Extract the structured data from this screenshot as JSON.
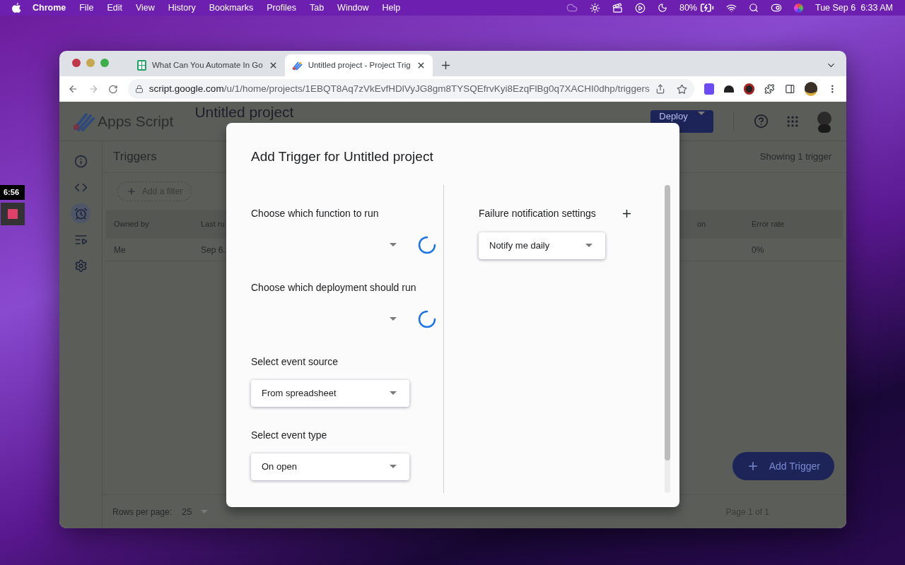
{
  "menubar": {
    "app": "Chrome",
    "menus": [
      "File",
      "Edit",
      "View",
      "History",
      "Bookmarks",
      "Profiles",
      "Tab",
      "Window",
      "Help"
    ],
    "battery": "80%",
    "clock": "Tue Sep 6  6:33 AM"
  },
  "recorder": {
    "time": "6:56"
  },
  "browser": {
    "tabs": [
      {
        "title": "What Can You Automate In Go",
        "kind": "sheets",
        "selected": false
      },
      {
        "title": "Untitled project - Project Trig",
        "kind": "script",
        "selected": true
      }
    ],
    "url": {
      "host": "script.google.com",
      "path": "/u/1/home/projects/1EBQT8Aq7zVkEvfHDlVyJG8gm8TYSQEfrvKyi8EzqFlBg0q7XACHI0dhp/triggers"
    }
  },
  "app": {
    "product": "Apps Script",
    "project": "Untitled project",
    "deploy": "Deploy",
    "nav": [
      {
        "kind": "info",
        "selected": false
      },
      {
        "kind": "code",
        "selected": false
      },
      {
        "kind": "clock",
        "selected": true
      },
      {
        "kind": "executions",
        "selected": false
      },
      {
        "kind": "settings",
        "selected": false
      }
    ],
    "title": "Triggers",
    "count": "Showing 1 trigger",
    "filter": "Add a filter",
    "table": {
      "columns": [
        "Owned by",
        "Last ru",
        "on",
        "Error rate"
      ],
      "rows": [
        [
          "Me",
          "Sep 6.",
          "",
          "0%"
        ]
      ]
    },
    "rows_per_page_label": "Rows per page:",
    "rows_per_page": "25",
    "page": "Page 1 of 1",
    "add_button": "Add Trigger"
  },
  "dialog": {
    "title": "Add Trigger for Untitled project",
    "fields": [
      {
        "label": "Choose which function to run",
        "kind": "loading"
      },
      {
        "label": "Choose which deployment should run",
        "kind": "loading"
      },
      {
        "label": "Select event source",
        "kind": "select",
        "value": "From spreadsheet"
      },
      {
        "label": "Select event type",
        "kind": "select",
        "value": "On open"
      }
    ],
    "notification": {
      "label": "Failure notification settings",
      "value": "Notify me daily"
    }
  }
}
